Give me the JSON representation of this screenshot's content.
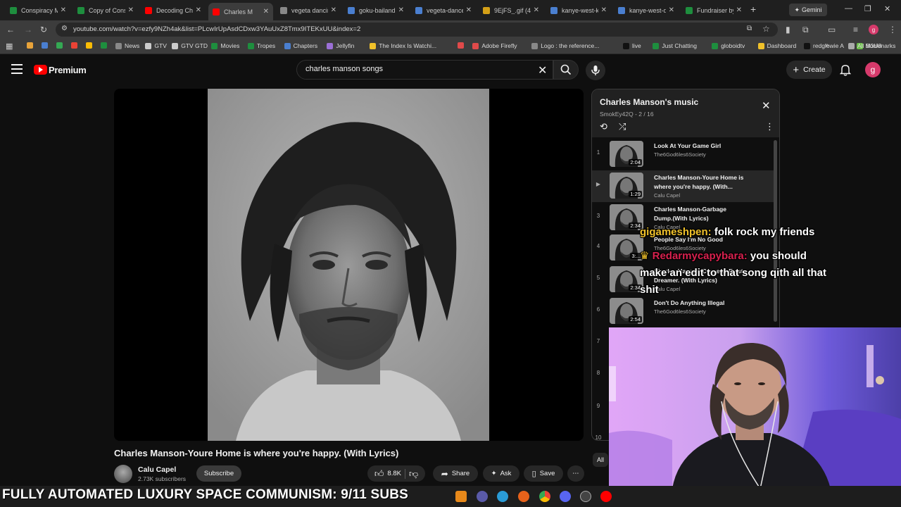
{
  "browser": {
    "tabs": [
      {
        "label": "Conspiracy M",
        "color": "#1e8e3e"
      },
      {
        "label": "Copy of Cons",
        "color": "#1e8e3e"
      },
      {
        "label": "Decoding Ch",
        "color": "#ff0000"
      },
      {
        "label": "Charles M",
        "color": "#ff0000",
        "active": true
      },
      {
        "label": "vegeta dancin",
        "color": "#888888"
      },
      {
        "label": "goku-bailand",
        "color": "#4a7fd0"
      },
      {
        "label": "vegeta-dance",
        "color": "#4a7fd0"
      },
      {
        "label": "9EjFS_.gif (48",
        "color": "#d4a017"
      },
      {
        "label": "kanye-west-k",
        "color": "#4a7fd0"
      },
      {
        "label": "kanye-west-d",
        "color": "#4a7fd0"
      },
      {
        "label": "Fundraiser by",
        "color": "#1e8e3e"
      }
    ],
    "gemini_label": "Gemini",
    "url": "youtube.com/watch?v=ezfy9NZh4ak&list=PLcwIrUpAsdCDxw3YAuUxZ8Tmx9ITEKxUU&index=2",
    "bookmarks": [
      {
        "label": "",
        "color": "#e8a33a"
      },
      {
        "label": "",
        "color": "#4a7fd0"
      },
      {
        "label": "",
        "color": "#34a853"
      },
      {
        "label": "",
        "color": "#ea4335"
      },
      {
        "label": "",
        "color": "#fbbc05"
      },
      {
        "label": "",
        "color": "#1e8e3e"
      },
      {
        "label": "News",
        "color": "#888888"
      },
      {
        "label": "GTV",
        "color": "#cccccc"
      },
      {
        "label": "GTV GTD",
        "color": "#cccccc"
      },
      {
        "label": "Movies",
        "color": "#1e8e3e"
      },
      {
        "label": "Tropes",
        "color": "#1e8e3e"
      },
      {
        "label": "Chapters",
        "color": "#4a7fd0"
      },
      {
        "label": "Jellyfin",
        "color": "#9b6fd6"
      },
      {
        "label": "The Index Is Watchi...",
        "color": "#f0c12a"
      },
      {
        "label": "",
        "color": "#e04a4a"
      },
      {
        "label": "Adobe Firefly",
        "color": "#e04a4a"
      },
      {
        "label": "Logo : the reference...",
        "color": "#888888"
      },
      {
        "label": "live",
        "color": "#111111"
      },
      {
        "label": "Just Chatting",
        "color": "#1e8e3e"
      },
      {
        "label": "globoidtv",
        "color": "#1e8e3e"
      },
      {
        "label": "Dashboard",
        "color": "#f0c12a"
      },
      {
        "label": "redglowie A",
        "color": "#111111"
      },
      {
        "label": "M3U8",
        "color": "#6cc04a"
      }
    ],
    "all_bookmarks": "All Bookmarks"
  },
  "youtube": {
    "brand": "Premium",
    "search_value": "charles manson songs",
    "create_label": "Create",
    "avatar_letter": "g"
  },
  "video": {
    "title": "Charles Manson-Youre Home is where you're happy. (With Lyrics)",
    "channel": "Calu Capel",
    "subscribers": "2.73K subscribers",
    "subscribe": "Subscribe",
    "likes": "8.8K",
    "share": "Share",
    "ask": "Ask",
    "save": "Save"
  },
  "playlist": {
    "title": "Charles Manson's music",
    "owner": "SmokEy42Q",
    "position": "2 / 16",
    "items": [
      {
        "index": "1",
        "title": "Look At Your Game Girl",
        "channel": "The6God6les6Society",
        "duration": "2:04"
      },
      {
        "index": "▶",
        "title": "Charles Manson-Youre Home is where you're happy. (With...",
        "channel": "Calu Capel",
        "duration": "1:29"
      },
      {
        "index": "3",
        "title": "Charles Manson-Garbage Dump.(With Lyrics)",
        "channel": "Calu Capel",
        "duration": "2:34"
      },
      {
        "index": "4",
        "title": "People Say I'm No Good",
        "channel": "The6God6les6Society",
        "duration": "3:..."
      },
      {
        "index": "5",
        "title": "Charles Manson-Cease to Exist Dreamer. (With Lyrics)",
        "channel": "Calu Capel",
        "duration": "2:34"
      },
      {
        "index": "6",
        "title": "Don't Do Anything Illegal",
        "channel": "The6God6les6Society",
        "duration": "2:54"
      },
      {
        "index": "7",
        "title": "",
        "channel": "",
        "duration": ""
      },
      {
        "index": "8",
        "title": "",
        "channel": "",
        "duration": ""
      },
      {
        "index": "9",
        "title": "",
        "channel": "",
        "duration": ""
      },
      {
        "index": "10",
        "title": "",
        "channel": "",
        "duration": ""
      }
    ],
    "chip_all": "All"
  },
  "chat": [
    {
      "user": "gigameshpen:",
      "message": "folk rock my friends"
    },
    {
      "user": "Redarmycapybara:",
      "message": "you should",
      "continuation": [
        "make an edit to that song qith all that",
        "shit"
      ]
    }
  ],
  "stream": {
    "ticker": "FULLY AUTOMATED LUXURY SPACE COMMUNISM: 9/11 SUBS"
  },
  "colors": {
    "accent_red": "#ff0000",
    "chat_user_1": "#f0c12a",
    "chat_user_2": "#d8214e"
  }
}
